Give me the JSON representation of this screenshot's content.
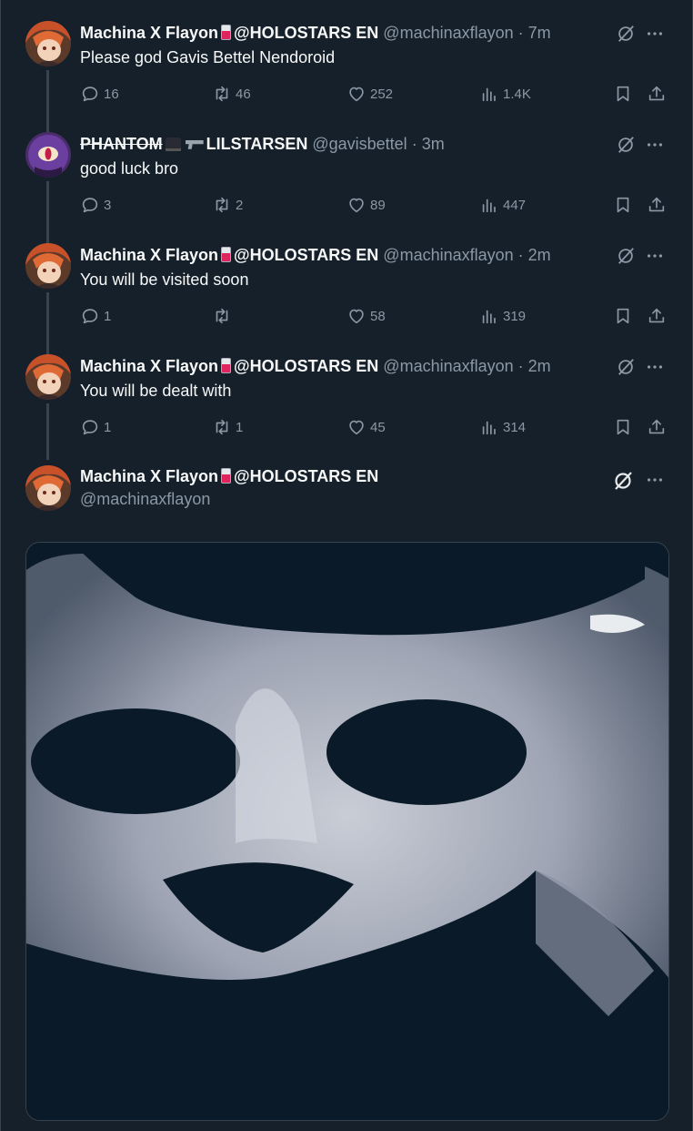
{
  "tweets": [
    {
      "name": "Machina X Flayon",
      "affiliation": "@HOLOSTARS EN",
      "handle": "@machinaxflayon",
      "dot": "·",
      "time": "7m",
      "text": "Please god Gavis Bettel Nendoroid",
      "replies": "16",
      "retweets": "46",
      "likes": "252",
      "views": "1.4K"
    },
    {
      "name": "PHANTOM",
      "affiliation": "LILSTARSEN",
      "handle": "@gavisbettel",
      "dot": "·",
      "time": "3m",
      "text": "good luck bro",
      "replies": "3",
      "retweets": "2",
      "likes": "89",
      "views": "447"
    },
    {
      "name": "Machina X Flayon",
      "affiliation": "@HOLOSTARS EN",
      "handle": "@machinaxflayon",
      "dot": "·",
      "time": "2m",
      "text": "You will be visited soon",
      "replies": "1",
      "retweets": "",
      "likes": "58",
      "views": "319"
    },
    {
      "name": "Machina X Flayon",
      "affiliation": "@HOLOSTARS EN",
      "handle": "@machinaxflayon",
      "dot": "·",
      "time": "2m",
      "text": "You will be dealt with",
      "replies": "1",
      "retweets": "1",
      "likes": "45",
      "views": "314"
    }
  ],
  "main_tweet": {
    "name": "Machina X Flayon",
    "affiliation": "@HOLOSTARS EN",
    "handle": "@machinaxflayon"
  },
  "icons": {
    "reply": "reply-icon",
    "retweet": "retweet-icon",
    "like": "like-icon",
    "views": "views-icon",
    "bookmark": "bookmark-icon",
    "share": "share-icon",
    "grok": "grok-icon",
    "more": "more-icon"
  },
  "colors": {
    "background": "#15202b",
    "text": "#f7f9f9",
    "secondary": "#8b98a5",
    "border": "#38444d"
  }
}
